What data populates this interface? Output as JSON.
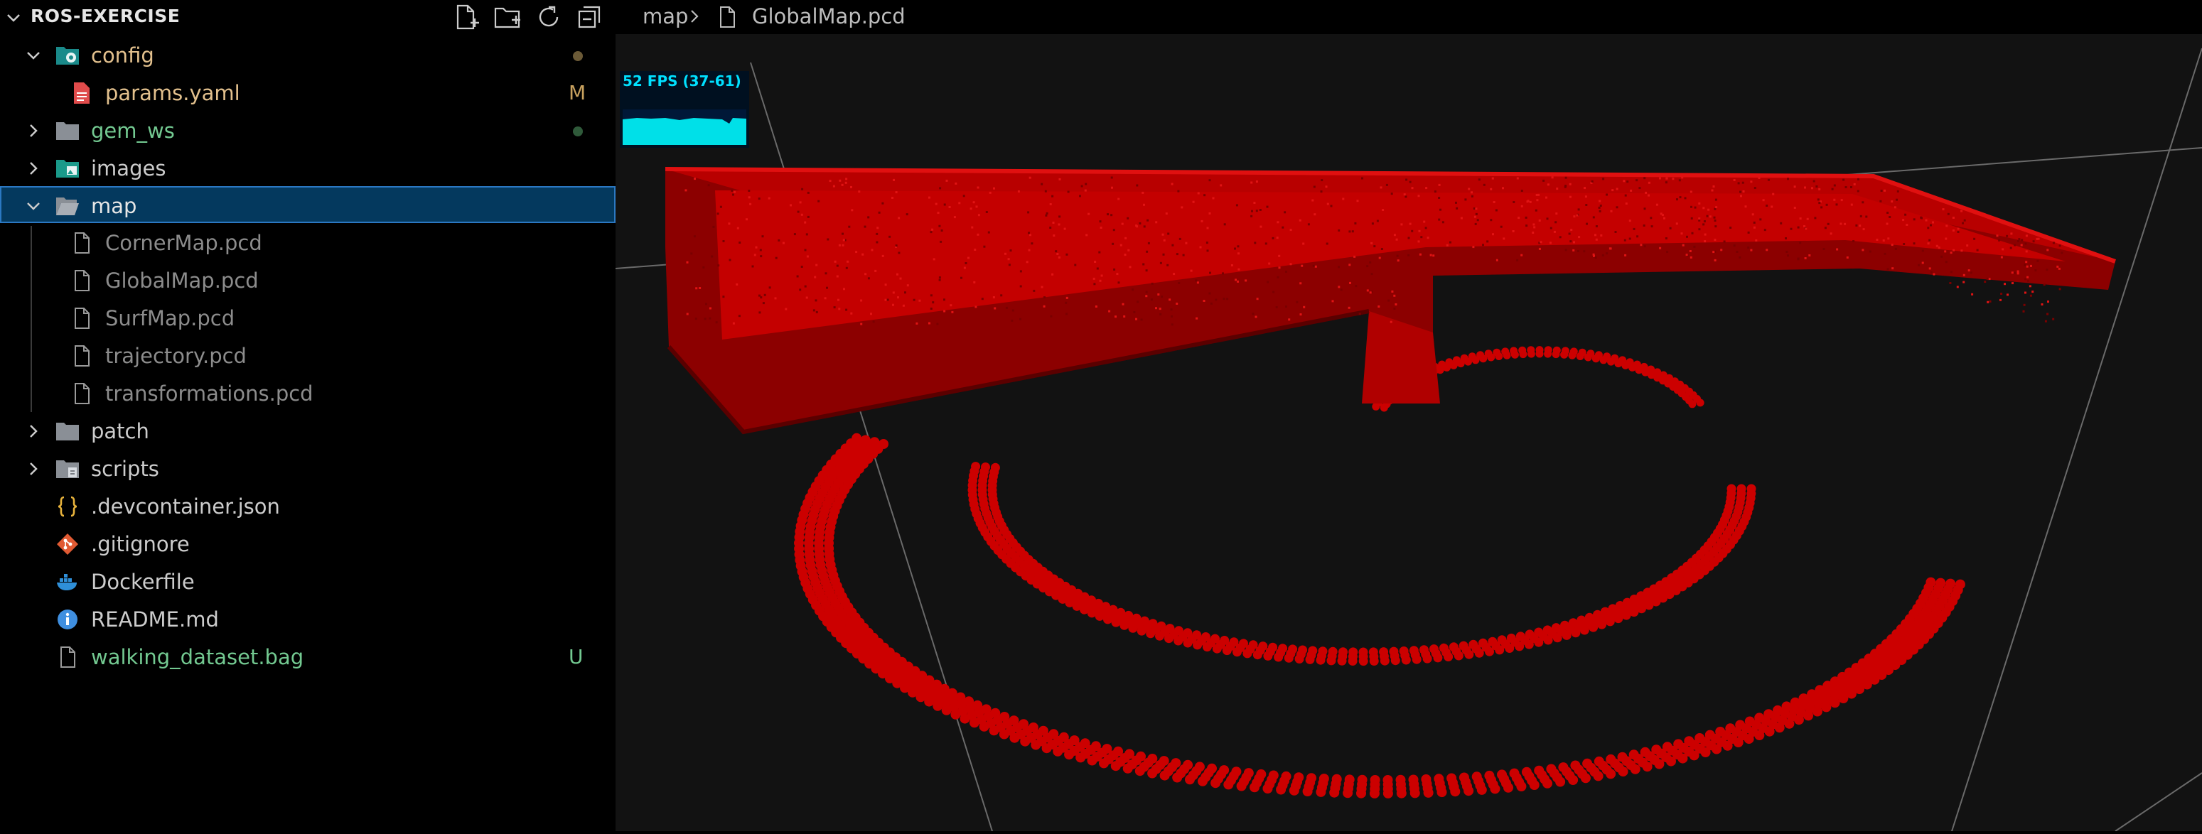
{
  "explorer": {
    "title": "ROS-EXERCISE",
    "actions": [
      "new-file-icon",
      "new-folder-icon",
      "refresh-icon",
      "collapse-all-icon"
    ],
    "items": [
      {
        "label": "config",
        "type": "folder",
        "expanded": true,
        "color": "#e2c08d",
        "status": "dot",
        "status_color": "#6b5a37"
      },
      {
        "label": "params.yaml",
        "type": "file",
        "color": "#e2c08d",
        "status": "M",
        "status_color": "#c9a25f"
      },
      {
        "label": "gem_ws",
        "type": "folder",
        "expanded": false,
        "color": "#73c991",
        "status": "dot",
        "status_color": "#2f5a3a"
      },
      {
        "label": "images",
        "type": "folder",
        "expanded": false,
        "color": "#cccccc"
      },
      {
        "label": "map",
        "type": "folder",
        "expanded": true,
        "color": "#e6e6e6",
        "selected": true
      },
      {
        "label": "CornerMap.pcd",
        "type": "file",
        "color": "#8c8c8c"
      },
      {
        "label": "GlobalMap.pcd",
        "type": "file",
        "color": "#8c8c8c"
      },
      {
        "label": "SurfMap.pcd",
        "type": "file",
        "color": "#8c8c8c"
      },
      {
        "label": "trajectory.pcd",
        "type": "file",
        "color": "#8c8c8c"
      },
      {
        "label": "transformations.pcd",
        "type": "file",
        "color": "#8c8c8c"
      },
      {
        "label": "patch",
        "type": "folder",
        "expanded": false,
        "color": "#cccccc"
      },
      {
        "label": "scripts",
        "type": "folder",
        "expanded": false,
        "color": "#cccccc"
      },
      {
        "label": ".devcontainer.json",
        "type": "file",
        "color": "#cccccc"
      },
      {
        "label": ".gitignore",
        "type": "file",
        "color": "#cccccc"
      },
      {
        "label": "Dockerfile",
        "type": "file",
        "color": "#cccccc"
      },
      {
        "label": "README.md",
        "type": "file",
        "color": "#cccccc"
      },
      {
        "label": "walking_dataset.bag",
        "type": "file",
        "color": "#73c991",
        "status": "U",
        "status_color": "#73c991"
      }
    ]
  },
  "breadcrumb": {
    "folder": "map",
    "file": "GlobalMap.pcd"
  },
  "viewer": {
    "fps_text": "52 FPS (37-61)",
    "point_color": "#cc0000",
    "background": "#121212"
  }
}
